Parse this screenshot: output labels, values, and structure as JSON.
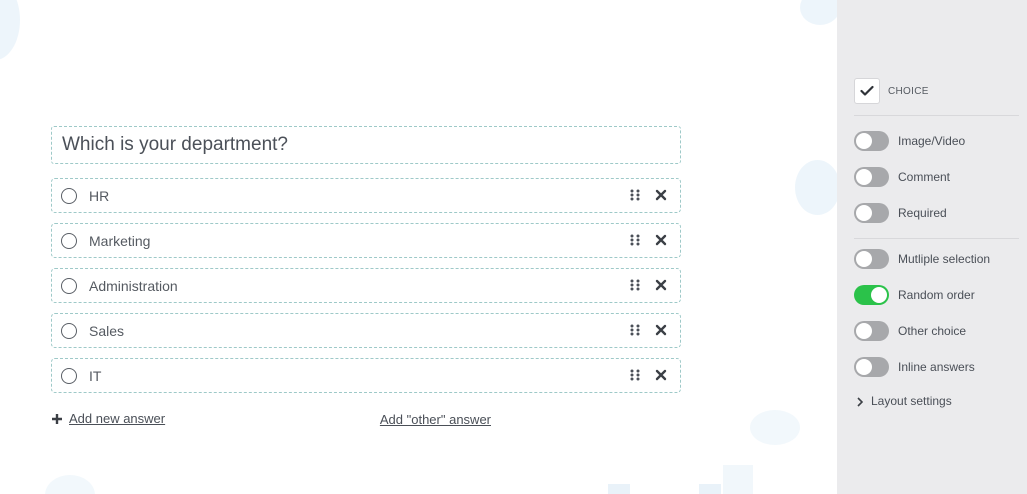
{
  "question": {
    "title": "Which is your department?"
  },
  "answers": [
    {
      "label": "HR"
    },
    {
      "label": "Marketing"
    },
    {
      "label": "Administration"
    },
    {
      "label": "Sales"
    },
    {
      "label": "IT"
    }
  ],
  "actions": {
    "add_new": "Add new answer",
    "add_other": "Add \"other\" answer"
  },
  "sidebar": {
    "type_label": "CHOICE",
    "type_checked": true,
    "toggles": [
      {
        "label": "Image/Video",
        "on": false
      },
      {
        "label": "Comment",
        "on": false
      },
      {
        "label": "Required",
        "on": false
      },
      {
        "label": "Mutliple selection",
        "on": false
      },
      {
        "label": "Random order",
        "on": true
      },
      {
        "label": "Other choice",
        "on": false
      },
      {
        "label": "Inline answers",
        "on": false
      }
    ],
    "layout_settings": "Layout settings"
  },
  "colors": {
    "toggle_on": "#2bc24a",
    "toggle_off": "#a7a8ab",
    "border_dashed": "#9ec9c8",
    "sidebar_bg": "#ebebed"
  }
}
